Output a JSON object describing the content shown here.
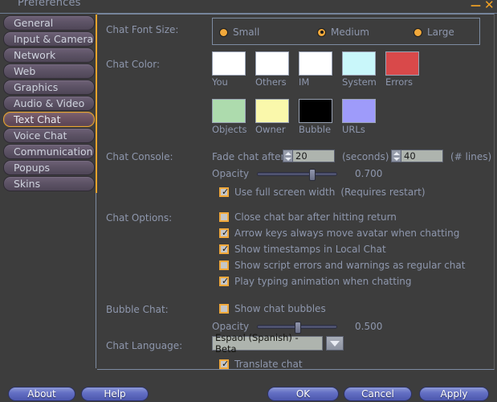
{
  "window": {
    "title": "Preferences",
    "minimize_icon": "minimize-icon",
    "close_icon": "close-icon"
  },
  "sidebar": {
    "items": [
      {
        "label": "General",
        "active": false
      },
      {
        "label": "Input & Camera",
        "active": false
      },
      {
        "label": "Network",
        "active": false
      },
      {
        "label": "Web",
        "active": false
      },
      {
        "label": "Graphics",
        "active": false
      },
      {
        "label": "Audio & Video",
        "active": false
      },
      {
        "label": "Text Chat",
        "active": true
      },
      {
        "label": "Voice Chat",
        "active": false
      },
      {
        "label": "Communication",
        "active": false
      },
      {
        "label": "Popups",
        "active": false
      },
      {
        "label": "Skins",
        "active": false
      }
    ]
  },
  "main": {
    "font_size": {
      "label": "Chat Font Size:",
      "options": [
        {
          "label": "Small",
          "selected": false
        },
        {
          "label": "Medium",
          "selected": true
        },
        {
          "label": "Large",
          "selected": false
        }
      ]
    },
    "chat_color": {
      "label": "Chat Color:",
      "swatches": [
        {
          "label": "You",
          "color": "#ffffff"
        },
        {
          "label": "Others",
          "color": "#ffffff"
        },
        {
          "label": "IM",
          "color": "#ffffff"
        },
        {
          "label": "System",
          "color": "#c9f7fa"
        },
        {
          "label": "Errors",
          "color": "#d9494a"
        },
        {
          "label": "Objects",
          "color": "#addbad"
        },
        {
          "label": "Owner",
          "color": "#faf8ab"
        },
        {
          "label": "Bubble",
          "color": "#000000"
        },
        {
          "label": "URLs",
          "color": "#9e9bfa"
        }
      ]
    },
    "chat_console": {
      "label": "Chat Console:",
      "fade_label": "Fade chat after",
      "fade_value": "20",
      "seconds_label": "(seconds)",
      "lines_value": "40",
      "lines_label": "(# lines)",
      "opacity_label": "Opacity",
      "opacity_value": "0.700",
      "opacity_percent": 70,
      "full_width": {
        "label": "Use full screen width",
        "checked": true
      },
      "full_width_note": "(Requires restart)"
    },
    "chat_options": {
      "label": "Chat Options:",
      "items": [
        {
          "label": "Close chat bar after hitting return",
          "checked": false
        },
        {
          "label": "Arrow keys always move avatar when chatting",
          "checked": true
        },
        {
          "label": "Show timestamps in Local Chat",
          "checked": true
        },
        {
          "label": "Show script errors and warnings as regular chat",
          "checked": false
        },
        {
          "label": "Play typing animation when chatting",
          "checked": true
        }
      ]
    },
    "bubble_chat": {
      "label": "Bubble Chat:",
      "show_bubbles": {
        "label": "Show chat bubbles",
        "checked": false
      },
      "opacity_label": "Opacity",
      "opacity_value": "0.500",
      "opacity_percent": 50
    },
    "chat_language": {
      "label": "Chat Language:",
      "selected": "Espaol (Spanish) - Beta",
      "translate": {
        "label": "Translate chat",
        "checked": true
      }
    }
  },
  "footer": {
    "about": "About",
    "help": "Help",
    "ok": "OK",
    "cancel": "Cancel",
    "apply": "Apply"
  }
}
